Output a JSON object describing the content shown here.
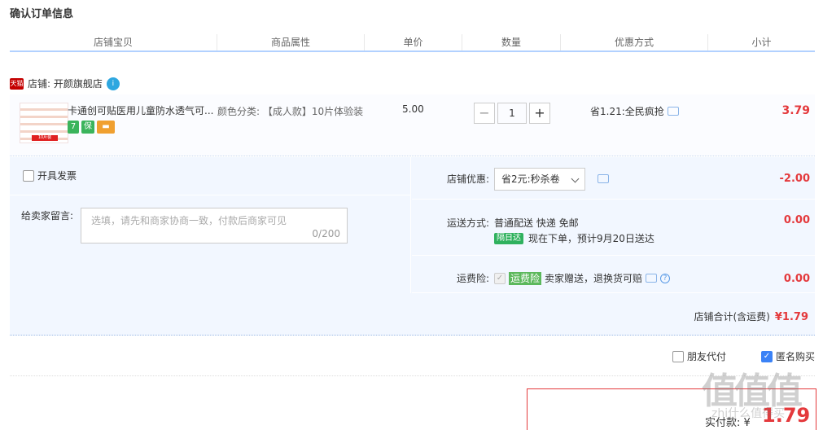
{
  "page_title": "确认订单信息",
  "columns": [
    "店铺宝贝",
    "商品属性",
    "单价",
    "数量",
    "优惠方式",
    "小计"
  ],
  "shop": {
    "badge": "天猫",
    "label": "店铺: 开颜旗舰店",
    "wangwang": "i"
  },
  "item": {
    "thumb_label": "10片装",
    "title": "卡通创可贴医用儿童防水透气可...",
    "service_icons": [
      {
        "name": "seven-day-return-icon",
        "text": "7",
        "color": "#3bb45c"
      },
      {
        "name": "guarantee-icon",
        "text": "保",
        "color": "#3bb45c"
      },
      {
        "name": "credit-card-icon",
        "text": "▬",
        "color": "#f0a030"
      }
    ],
    "attr": "颜色分类: 【成人款】10片体验装",
    "price": "5.00",
    "quantity": "1",
    "minus": "−",
    "plus": "+",
    "discount": "省1.21:全民疯抢",
    "subtotal": "3.79"
  },
  "invoice_label": "开具发票",
  "message": {
    "label": "给卖家留言:",
    "placeholder": "选填，请先和商家协商一致，付款后商家可见",
    "count": "0/200"
  },
  "store_coupon": {
    "label": "店铺优惠:",
    "selected": "省2元:秒杀卷",
    "amount": "-2.00"
  },
  "shipping": {
    "label": "运送方式:",
    "line1": "普通配送 快递 免邮",
    "badge": "隔日达",
    "line2": "现在下单，预计9月20日送达",
    "amount": "0.00"
  },
  "insurance": {
    "label": "运费险:",
    "tag": "运费险",
    "text": "卖家赠送，退换货可赔",
    "help": "?",
    "amount": "0.00"
  },
  "shop_total": {
    "label": "店铺合计(含运费)",
    "amount": "¥1.79"
  },
  "friend_pay_label": "朋友代付",
  "anonymous_label": "匿名购买",
  "pay": {
    "label": "实付款: ¥",
    "amount": "1.79"
  },
  "watermark": {
    "main": "值值值",
    "sub": "zhi什么值得买"
  }
}
